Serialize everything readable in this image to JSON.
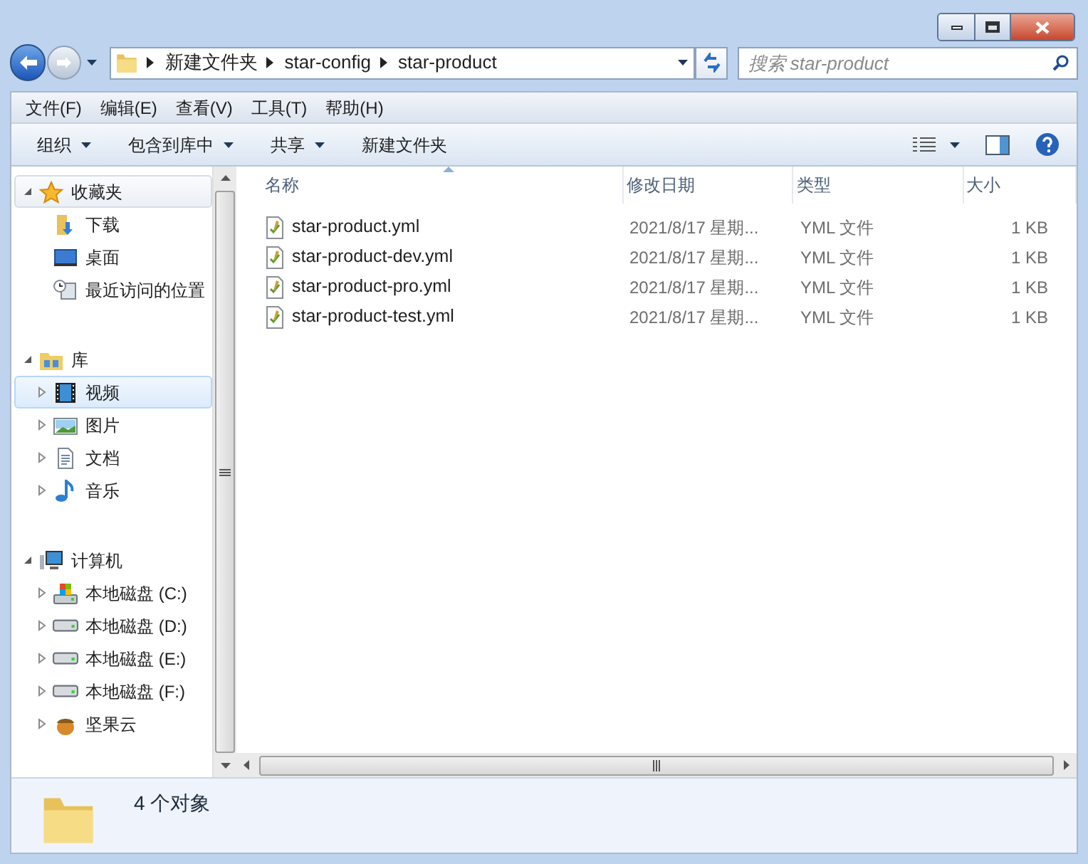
{
  "address": {
    "crumbs": [
      "新建文件夹",
      "star-config",
      "star-product"
    ]
  },
  "search": {
    "placeholder": "搜索 star-product"
  },
  "menu": [
    "文件(F)",
    "编辑(E)",
    "查看(V)",
    "工具(T)",
    "帮助(H)"
  ],
  "toolbar": [
    {
      "label": "组织",
      "dropdown": true
    },
    {
      "label": "包含到库中",
      "dropdown": true
    },
    {
      "label": "共享",
      "dropdown": true
    },
    {
      "label": "新建文件夹",
      "dropdown": false
    }
  ],
  "nav": [
    {
      "label": "收藏夹",
      "kind": "star",
      "expanded": true,
      "selected": false,
      "hover": true,
      "children": [
        {
          "label": "下载",
          "kind": "download",
          "expandable": false,
          "selected": false
        },
        {
          "label": "桌面",
          "kind": "desktop",
          "expandable": false,
          "selected": false
        },
        {
          "label": "最近访问的位置",
          "kind": "recent",
          "expandable": false,
          "selected": false
        }
      ]
    },
    {
      "label": "库",
      "kind": "library",
      "expanded": true,
      "selected": false,
      "hover": false,
      "children": [
        {
          "label": "视频",
          "kind": "video",
          "expandable": true,
          "selected": true
        },
        {
          "label": "图片",
          "kind": "picture",
          "expandable": true,
          "selected": false
        },
        {
          "label": "文档",
          "kind": "document",
          "expandable": true,
          "selected": false
        },
        {
          "label": "音乐",
          "kind": "music",
          "expandable": true,
          "selected": false
        }
      ]
    },
    {
      "label": "计算机",
      "kind": "computer",
      "expanded": true,
      "selected": false,
      "hover": false,
      "children": [
        {
          "label": "本地磁盘 (C:)",
          "kind": "system-drive",
          "expandable": true,
          "selected": false
        },
        {
          "label": "本地磁盘 (D:)",
          "kind": "drive",
          "expandable": true,
          "selected": false
        },
        {
          "label": "本地磁盘 (E:)",
          "kind": "drive",
          "expandable": true,
          "selected": false
        },
        {
          "label": "本地磁盘 (F:)",
          "kind": "drive",
          "expandable": true,
          "selected": false
        },
        {
          "label": "坚果云",
          "kind": "nut",
          "expandable": true,
          "selected": false
        }
      ]
    }
  ],
  "table": {
    "columns": [
      {
        "label": "名称",
        "sorted": true
      },
      {
        "label": "修改日期",
        "sorted": false
      },
      {
        "label": "类型",
        "sorted": false
      },
      {
        "label": "大小",
        "sorted": false
      }
    ],
    "rows": [
      {
        "name": "star-product.yml",
        "date": "2021/8/17 星期...",
        "type": "YML 文件",
        "size": "1 KB"
      },
      {
        "name": "star-product-dev.yml",
        "date": "2021/8/17 星期...",
        "type": "YML 文件",
        "size": "1 KB"
      },
      {
        "name": "star-product-pro.yml",
        "date": "2021/8/17 星期...",
        "type": "YML 文件",
        "size": "1 KB"
      },
      {
        "name": "star-product-test.yml",
        "date": "2021/8/17 星期...",
        "type": "YML 文件",
        "size": "1 KB"
      }
    ]
  },
  "status_bar": {
    "text": "4 个对象"
  }
}
